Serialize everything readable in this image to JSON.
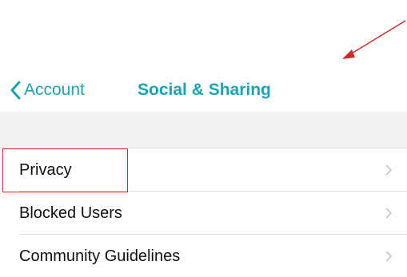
{
  "nav": {
    "back_label": "Account",
    "title": "Social & Sharing"
  },
  "list": {
    "items": [
      {
        "label": "Privacy"
      },
      {
        "label": "Blocked Users"
      },
      {
        "label": "Community Guidelines"
      }
    ]
  },
  "colors": {
    "accent": "#1aa3b3",
    "annotation": "#c9302c",
    "section_background": "#f2f2f4"
  },
  "icons": {
    "back": "chevron-left-icon",
    "row_disclosure": "chevron-right-icon"
  }
}
